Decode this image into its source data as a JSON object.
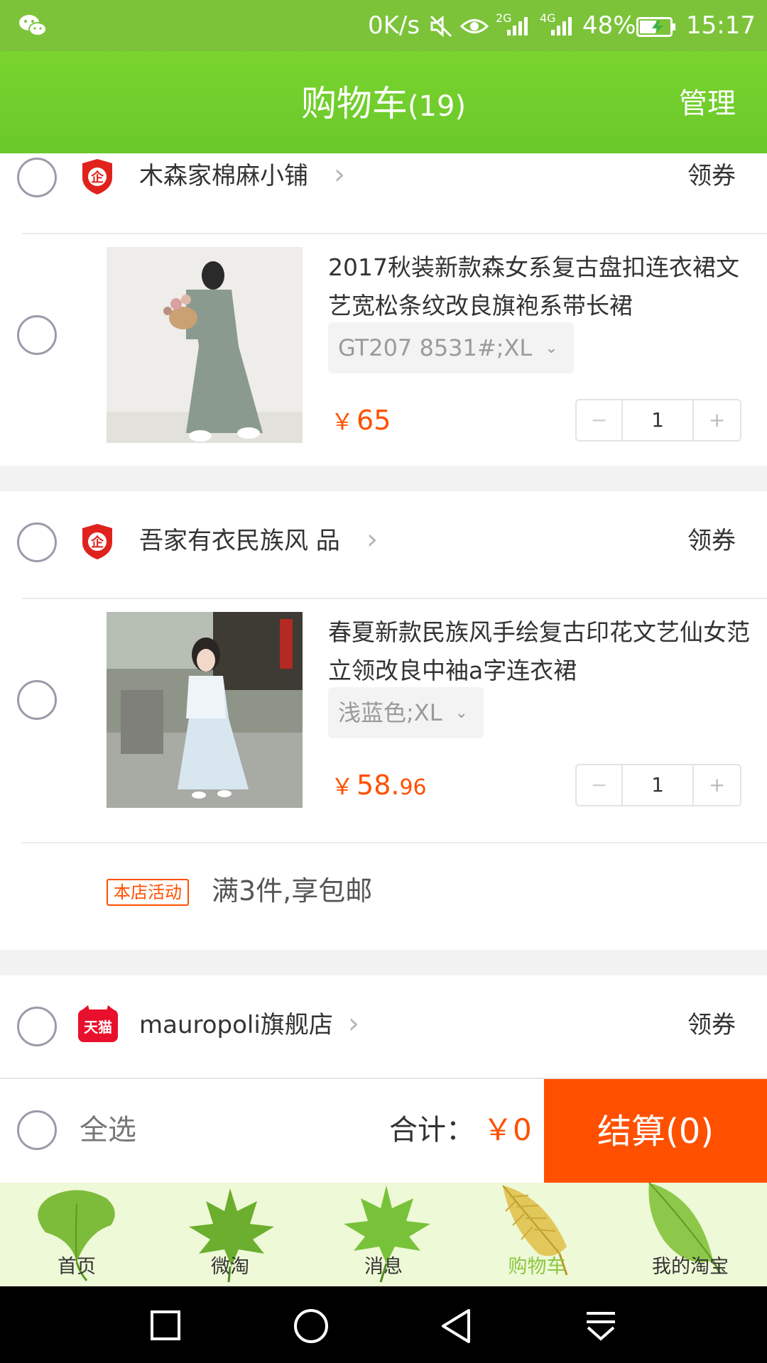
{
  "status_bar": {
    "net_speed": "0K/s",
    "sim1": "2G",
    "sim2": "4G",
    "battery": "48%",
    "time": "15:17",
    "icons": [
      "wechat-icon",
      "mute-icon",
      "eye-icon",
      "signal-icon",
      "battery-charging-icon"
    ]
  },
  "header": {
    "title": "购物车",
    "count": "(19)",
    "manage": "管理"
  },
  "shops": [
    {
      "name": "木森家棉麻小铺",
      "coupon": "领券",
      "badge": "企",
      "item": {
        "title": "2017秋装新款森女系复古盘扣连衣裙文艺宽松条纹改良旗袍系带长裙",
        "sku": "GT207 8531#;XL",
        "price_symbol": "￥",
        "price_int": "65",
        "price_dec": "",
        "quantity": "1"
      }
    },
    {
      "name": "吾家有衣民族风 品",
      "coupon": "领券",
      "badge": "企",
      "item": {
        "title": "春夏新款民族风手绘复古印花文艺仙女范立领改良中袖a字连衣裙",
        "sku": "浅蓝色;XL",
        "price_symbol": "￥",
        "price_int": "58.",
        "price_dec": "96",
        "quantity": "1"
      },
      "promo": {
        "tag": "本店活动",
        "text": "满3件,享包邮"
      }
    },
    {
      "name": "mauropoli旗舰店",
      "coupon": "领券",
      "badge": "天猫"
    }
  ],
  "checkout": {
    "select_all": "全选",
    "total_label": "合计：",
    "total_value": "￥0",
    "settle": "结算(0)"
  },
  "tabs": [
    {
      "label": "首页",
      "icon": "ginkgo-leaf-icon",
      "active": false
    },
    {
      "label": "微淘",
      "icon": "maple-leaf-icon",
      "active": false
    },
    {
      "label": "消息",
      "icon": "maple-leaf-icon",
      "active": false
    },
    {
      "label": "购物车",
      "icon": "palm-leaf-icon",
      "active": true
    },
    {
      "label": "我的淘宝",
      "icon": "leaf-icon",
      "active": false
    }
  ],
  "colors": {
    "brand_green": "#7cc33a",
    "accent_orange": "#ff5000",
    "tab_bg": "#eef9d7"
  }
}
